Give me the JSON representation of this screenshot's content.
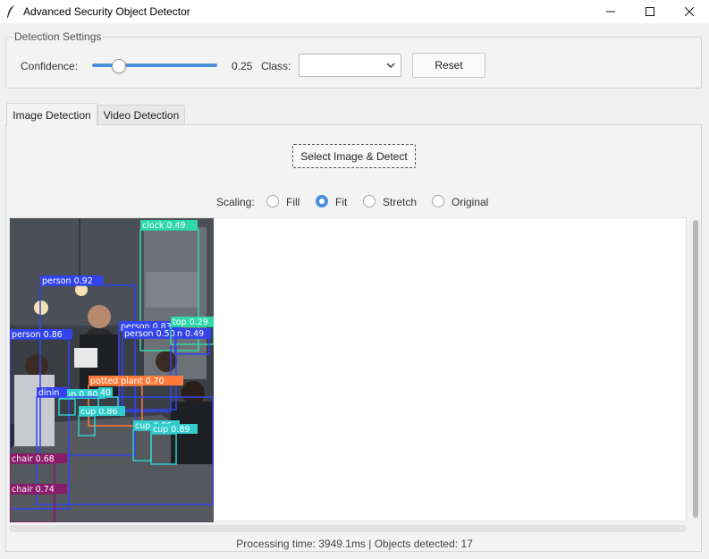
{
  "window": {
    "title": "Advanced Security Object Detector",
    "icon": "feather-icon"
  },
  "settings": {
    "legend": "Detection Settings",
    "confidence_label": "Confidence:",
    "confidence_value": "0.25",
    "confidence_level": 0.25,
    "class_label": "Class:",
    "class_value": "",
    "reset_label": "Reset"
  },
  "tabs": [
    {
      "label": "Image Detection",
      "active": true
    },
    {
      "label": "Video Detection",
      "active": false
    }
  ],
  "image_tab": {
    "select_button": "Select Image & Detect",
    "scaling_label": "Scaling:",
    "scaling_options": [
      {
        "label": "Fill",
        "selected": false
      },
      {
        "label": "Fit",
        "selected": true
      },
      {
        "label": "Stretch",
        "selected": false
      },
      {
        "label": "Original",
        "selected": false
      }
    ]
  },
  "detections": [
    {
      "label": "clock 0.49",
      "color": "#2fd9a8"
    },
    {
      "label": "person 0.92",
      "color": "#3344ee"
    },
    {
      "label": "person 0.83",
      "color": "#3344ee"
    },
    {
      "label": "person 0.50",
      "color": "#3344ee"
    },
    {
      "label": "person 0.86",
      "color": "#3344ee"
    },
    {
      "label": "top 0.29",
      "color": "#2fd9a8"
    },
    {
      "label": "n 0.49",
      "color": "#3344ee"
    },
    {
      "label": "potted plant 0.70",
      "color": "#ff7a3a"
    },
    {
      "label": "cup 0.80",
      "color": "#33cccc"
    },
    {
      "label": "cup 0.86",
      "color": "#33cccc"
    },
    {
      "label": "cup 0.86",
      "color": "#33cccc"
    },
    {
      "label": "cup 0.89",
      "color": "#33cccc"
    },
    {
      "label": "dinin",
      "color": "#3344ee"
    },
    {
      "label": "40",
      "color": "#33cccc"
    },
    {
      "label": "chair 0.68",
      "color": "#8a1a6a"
    },
    {
      "label": "chair 0.74",
      "color": "#8a1a6a"
    }
  ],
  "status": "Processing time: 3949.1ms | Objects detected: 17"
}
